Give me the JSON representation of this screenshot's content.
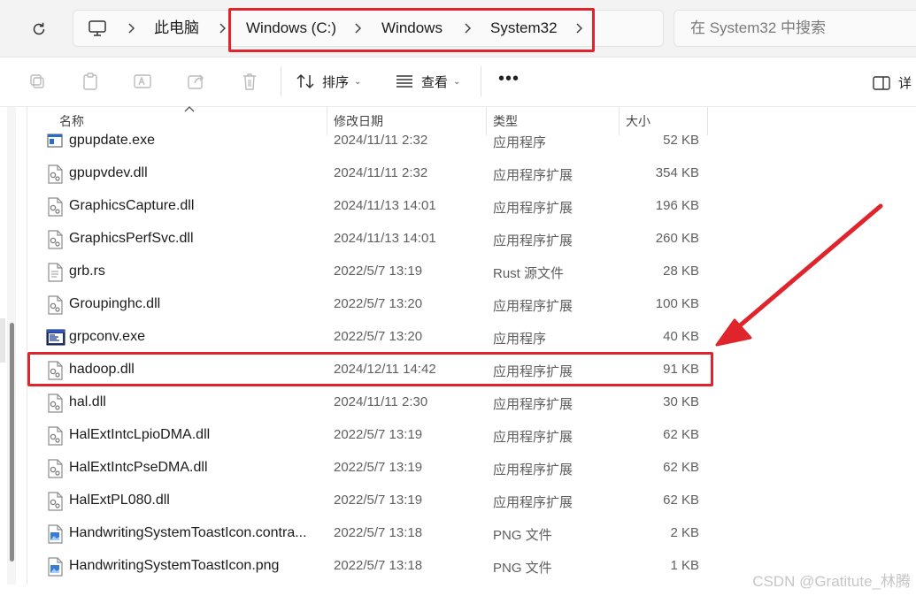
{
  "address_bar": {
    "crumbs": [
      "此电脑",
      "Windows (C:)",
      "Windows",
      "System32"
    ]
  },
  "search": {
    "placeholder": "在 System32 中搜索"
  },
  "toolbar": {
    "sort_label": "排序",
    "view_label": "查看",
    "more_label": "•••",
    "details_label": "详"
  },
  "columns": {
    "name": "名称",
    "date": "修改日期",
    "type": "类型",
    "size": "大小"
  },
  "files": [
    {
      "name": "gpupdate.exe",
      "date": "2024/11/11 2:32",
      "type": "应用程序",
      "size": "52 KB",
      "icon": "exe-icon"
    },
    {
      "name": "gpupvdev.dll",
      "date": "2024/11/11 2:32",
      "type": "应用程序扩展",
      "size": "354 KB",
      "icon": "dll-icon"
    },
    {
      "name": "GraphicsCapture.dll",
      "date": "2024/11/13 14:01",
      "type": "应用程序扩展",
      "size": "196 KB",
      "icon": "dll-icon"
    },
    {
      "name": "GraphicsPerfSvc.dll",
      "date": "2024/11/13 14:01",
      "type": "应用程序扩展",
      "size": "260 KB",
      "icon": "dll-icon"
    },
    {
      "name": "grb.rs",
      "date": "2022/5/7 13:19",
      "type": "Rust 源文件",
      "size": "28 KB",
      "icon": "text-file-icon"
    },
    {
      "name": "Groupinghc.dll",
      "date": "2022/5/7 13:20",
      "type": "应用程序扩展",
      "size": "100 KB",
      "icon": "dll-icon"
    },
    {
      "name": "grpconv.exe",
      "date": "2022/5/7 13:20",
      "type": "应用程序",
      "size": "40 KB",
      "icon": "app-window-icon"
    },
    {
      "name": "hadoop.dll",
      "date": "2024/12/11 14:42",
      "type": "应用程序扩展",
      "size": "91 KB",
      "icon": "dll-icon"
    },
    {
      "name": "hal.dll",
      "date": "2024/11/11 2:30",
      "type": "应用程序扩展",
      "size": "30 KB",
      "icon": "dll-icon"
    },
    {
      "name": "HalExtIntcLpioDMA.dll",
      "date": "2022/5/7 13:19",
      "type": "应用程序扩展",
      "size": "62 KB",
      "icon": "dll-icon"
    },
    {
      "name": "HalExtIntcPseDMA.dll",
      "date": "2022/5/7 13:19",
      "type": "应用程序扩展",
      "size": "62 KB",
      "icon": "dll-icon"
    },
    {
      "name": "HalExtPL080.dll",
      "date": "2022/5/7 13:19",
      "type": "应用程序扩展",
      "size": "62 KB",
      "icon": "dll-icon"
    },
    {
      "name": "HandwritingSystemToastIcon.contra...",
      "date": "2022/5/7 13:18",
      "type": "PNG 文件",
      "size": "2 KB",
      "icon": "image-file-icon"
    },
    {
      "name": "HandwritingSystemToastIcon.png",
      "date": "2022/5/7 13:18",
      "type": "PNG 文件",
      "size": "1 KB",
      "icon": "image-file-icon"
    }
  ],
  "watermark": "CSDN @Gratitute_林腾",
  "colors": {
    "annotation_red": "#e0242c"
  }
}
